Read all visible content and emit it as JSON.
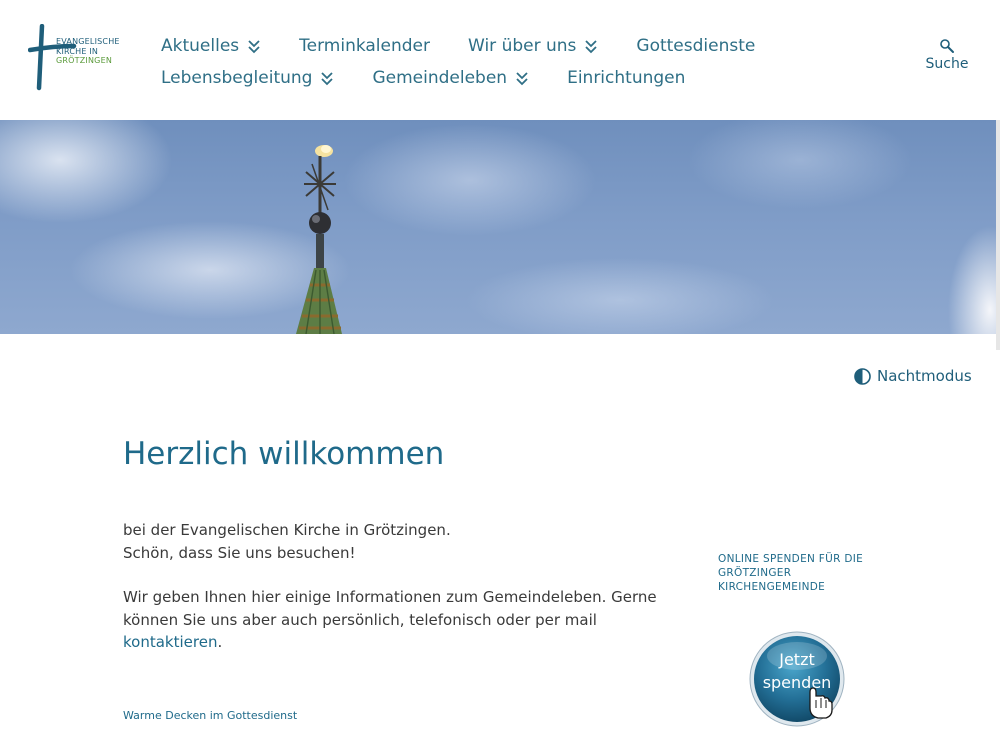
{
  "logo": {
    "line1": "EVANGELISCHE",
    "line2": "KIRCHE IN",
    "line3": "GRÖTZINGEN"
  },
  "nav": {
    "row1": [
      {
        "label": "Aktuelles",
        "dropdown": true
      },
      {
        "label": "Terminkalender",
        "dropdown": false
      },
      {
        "label": "Wir über uns",
        "dropdown": true
      },
      {
        "label": "Gottesdienste",
        "dropdown": false
      }
    ],
    "row2": [
      {
        "label": "Lebensbegleitung",
        "dropdown": true
      },
      {
        "label": "Gemeindeleben",
        "dropdown": true
      },
      {
        "label": "Einrichtungen",
        "dropdown": false
      }
    ]
  },
  "search": {
    "label": "Suche",
    "icon": "search-icon"
  },
  "nightmode": {
    "label": "Nachtmodus",
    "icon": "half-circle-icon"
  },
  "main": {
    "title": "Herzlich willkommen",
    "p1_line1": "bei der Evangelischen Kirche in Grötzingen.",
    "p1_line2": "Schön, dass Sie uns besuchen!",
    "p2_text": "Wir geben Ihnen hier einige Informationen zum Gemeindeleben. Gerne können Sie uns aber auch persönlich, telefonisch oder per mail ",
    "p2_link": "kontaktieren",
    "p2_end": ".",
    "news_link": "Warme Decken im Gottesdienst"
  },
  "sidebar": {
    "donate_heading": "ONLINE SPENDEN FÜR DIE GRÖTZINGER KIRCHENGEMEINDE",
    "donate_line1": "Jetzt",
    "donate_line2": "spenden"
  },
  "colors": {
    "brand": "#1f6a8a",
    "nav": "#2f6f86",
    "logo_green": "#5a9a3a"
  }
}
